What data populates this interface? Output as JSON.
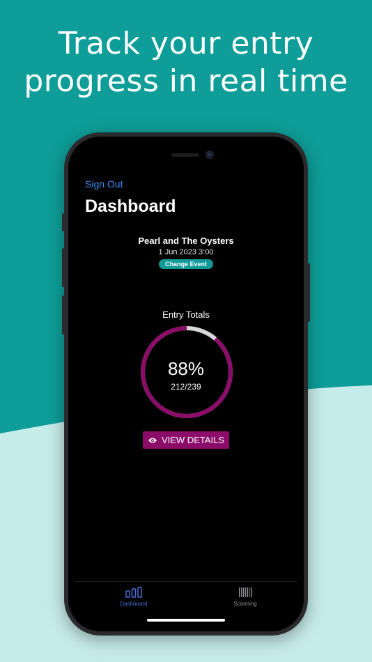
{
  "promo": {
    "headline_line1": "Track your entry",
    "headline_line2": "progress in real time"
  },
  "header": {
    "sign_out_label": "Sign Out",
    "title": "Dashboard"
  },
  "event": {
    "name": "Pearl and The Oysters",
    "date": "1 Jun 2023 3:00",
    "change_label": "Change Event"
  },
  "entry_totals": {
    "label": "Entry Totals",
    "percent_text": "88%",
    "count_text": "212/239",
    "entered": 212,
    "capacity": 239,
    "progress_fraction": 0.887
  },
  "actions": {
    "view_details_label": "VIEW DETAILS"
  },
  "tabbar": {
    "dashboard_label": "Dashboard",
    "scanning_label": "Scanning"
  },
  "colors": {
    "teal_background": "#0e9d98",
    "light_background": "#c6ecea",
    "accent_magenta": "#8c0c6a",
    "ring_track": "#d7d7d7",
    "link_blue": "#3b8ef2",
    "change_button_teal": "#0f9a97",
    "tab_active": "#4a6fd6",
    "tab_inactive": "#8e8e93"
  },
  "icons": {
    "eye": "eye-icon",
    "dashboard_tab": "bar-chart-icon",
    "scanning_tab": "barcode-icon"
  }
}
